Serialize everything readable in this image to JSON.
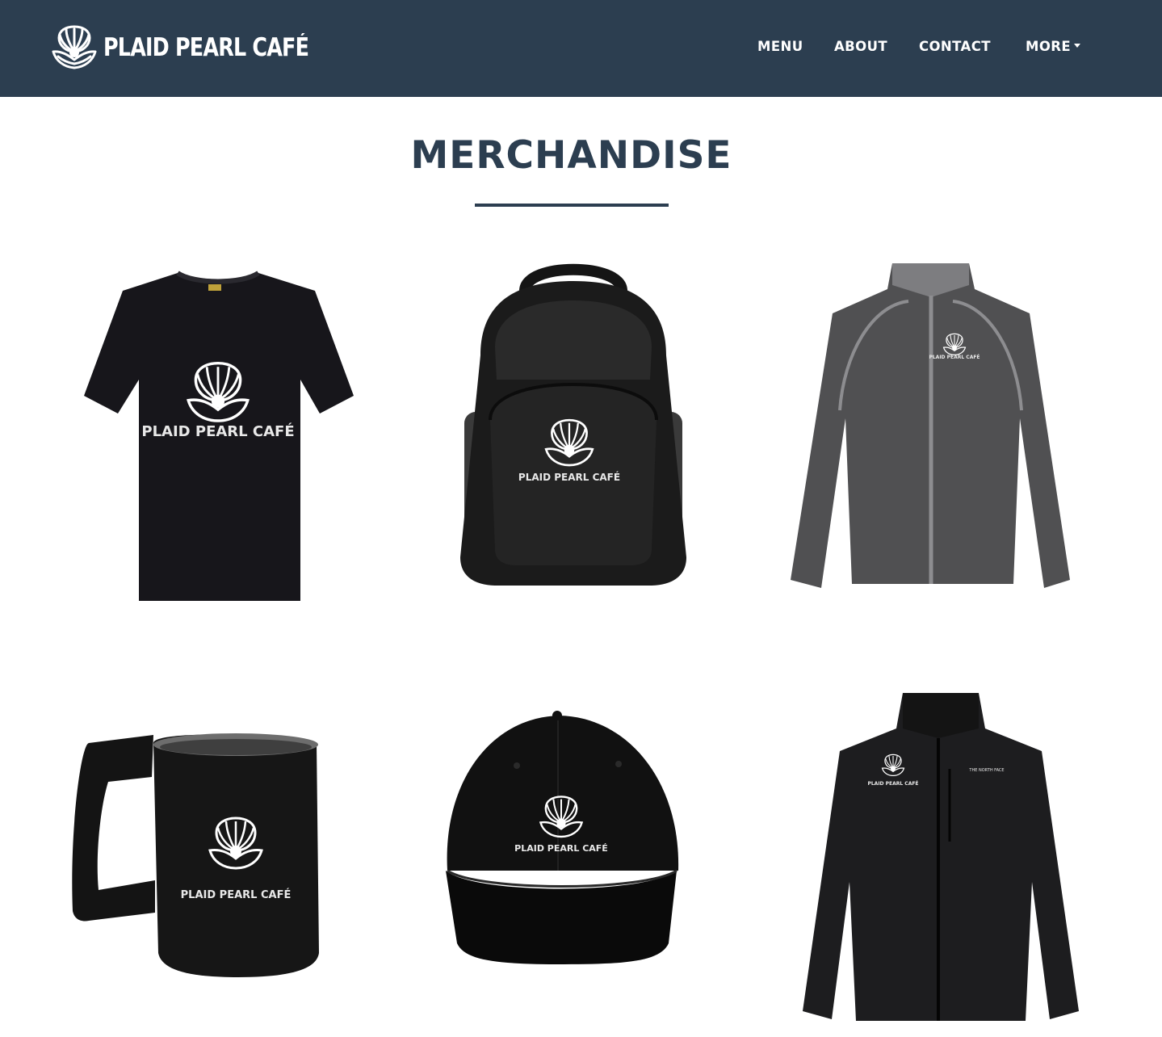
{
  "brand": {
    "name": "PLAID PEARL CAFÉ",
    "logo_icon": "shell-pearl-icon"
  },
  "nav": {
    "items": [
      {
        "label": "MENU"
      },
      {
        "label": "ABOUT"
      },
      {
        "label": "CONTACT"
      },
      {
        "label": "MORE",
        "has_dropdown": true
      }
    ]
  },
  "page": {
    "title": "MERCHANDISE"
  },
  "products": [
    {
      "type": "t-shirt",
      "print": "PLAID PEARL CAFÉ"
    },
    {
      "type": "backpack",
      "print": "PLAID PEARL CAFÉ"
    },
    {
      "type": "jacket",
      "print": "PLAID PEARL CAFÉ"
    },
    {
      "type": "mug",
      "print": "PLAID PEARL CAFÉ"
    },
    {
      "type": "cap",
      "print": "PLAID PEARL CAFÉ"
    },
    {
      "type": "fleece-jacket",
      "print": "PLAID PEARL CAFÉ",
      "extra_logo": "THE NORTH FACE"
    }
  ],
  "colors": {
    "navbar": "#2c3e50",
    "title": "#2c3e50",
    "nav_text": "#ffffff"
  }
}
